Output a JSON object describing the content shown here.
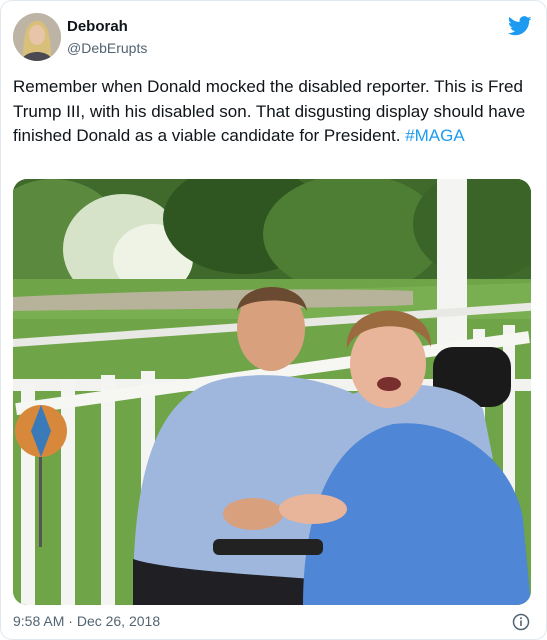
{
  "author": {
    "display_name": "Deborah",
    "handle": "@DebErupts"
  },
  "tweet": {
    "text": "Remember when Donald mocked the disabled reporter. This is Fred Trump III, with his disabled son. That disgusting display should have finished Donald as a viable candidate for President. ",
    "hashtag": "#MAGA",
    "time": "9:58 AM",
    "separator": " · ",
    "date": "Dec 26, 2018"
  },
  "icons": {
    "brand": "twitter-bird-icon",
    "info": "info-icon"
  },
  "colors": {
    "brand_blue": "#1d9bf0",
    "text_primary": "#0f1419",
    "text_secondary": "#536471"
  }
}
